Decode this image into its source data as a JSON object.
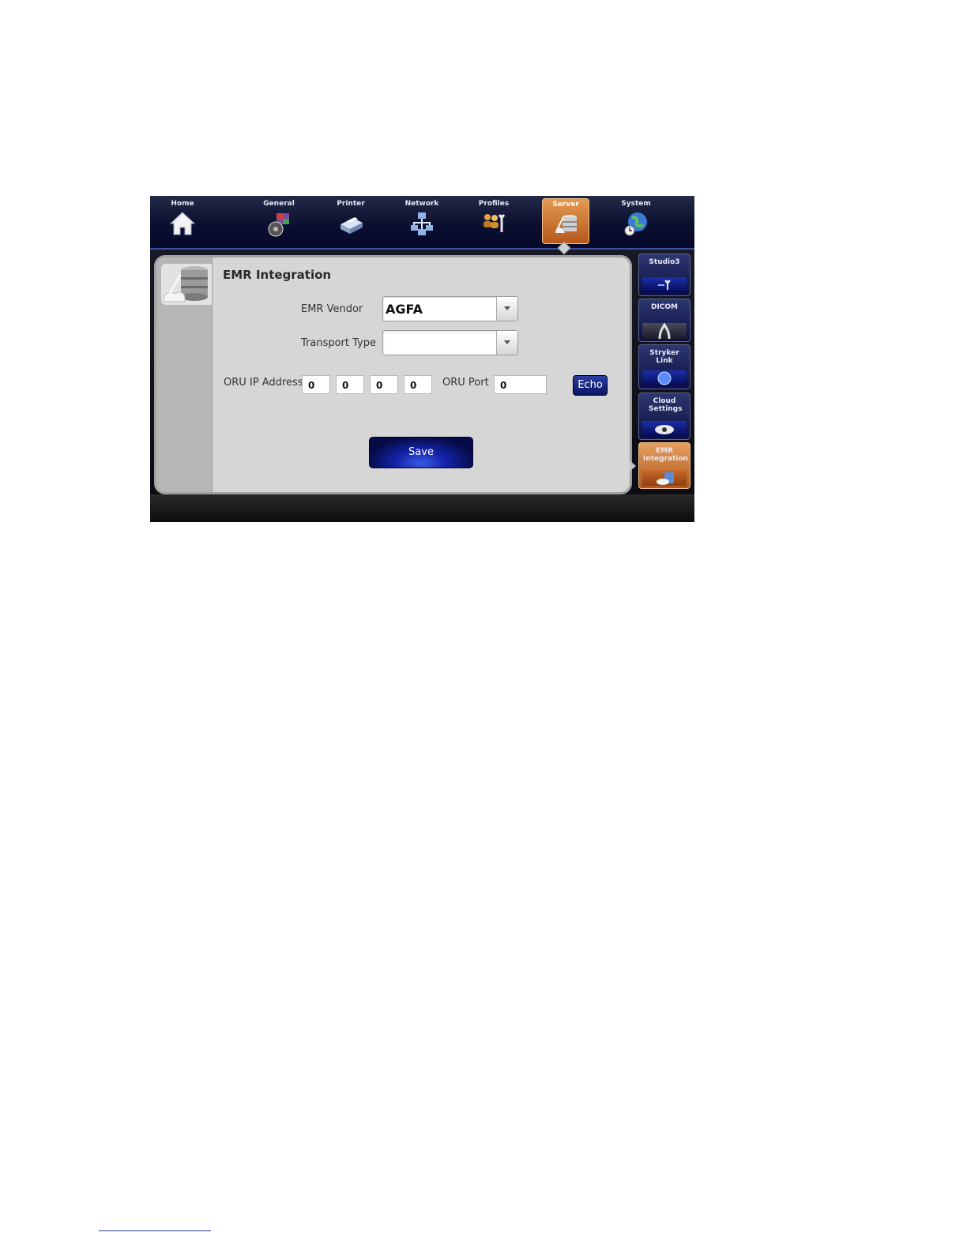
{
  "nav": {
    "items": [
      {
        "label": "Home",
        "icon": "home-icon"
      },
      {
        "label": "General",
        "icon": "general-icon"
      },
      {
        "label": "Printer",
        "icon": "printer-icon"
      },
      {
        "label": "Network",
        "icon": "network-icon"
      },
      {
        "label": "Profiles",
        "icon": "profiles-icon"
      },
      {
        "label": "Server",
        "icon": "server-icon",
        "active": true
      },
      {
        "label": "System",
        "icon": "system-icon"
      }
    ]
  },
  "panel": {
    "title": "EMR Integration",
    "icon": "database-icon",
    "emr_vendor": {
      "label": "EMR Vendor",
      "value": "AGFA"
    },
    "transport_type": {
      "label": "Transport Type",
      "value": ""
    },
    "oru_ip": {
      "label": "ORU IP Address",
      "octets": [
        "0",
        "0",
        "0",
        "0"
      ]
    },
    "oru_port": {
      "label": "ORU Port",
      "value": "0"
    },
    "echo_label": "Echo",
    "save_label": "Save"
  },
  "side_tabs": [
    {
      "label": "Studio3",
      "icon": "studio3-icon"
    },
    {
      "label": "DICOM",
      "icon": "dicom-icon"
    },
    {
      "label": "Stryker Link",
      "icon": "stryker-link-icon"
    },
    {
      "label": "Cloud Settings",
      "icon": "cloud-settings-icon"
    },
    {
      "label": "EMR Integration",
      "icon": "emr-integration-icon",
      "active": true
    }
  ],
  "colors": {
    "accent_active": "#d27a36",
    "nav_bg": "#0c1030",
    "button_blue": "#1323a8"
  }
}
